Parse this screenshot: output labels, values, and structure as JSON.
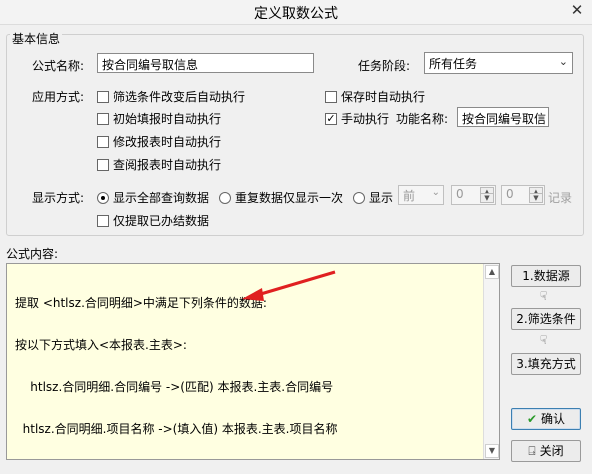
{
  "window": {
    "title": "定义取数公式",
    "close_glyph": "✕"
  },
  "basic": {
    "legend": "基本信息",
    "formula_name_label": "公式名称:",
    "formula_name_value": "按合同编号取信息",
    "task_stage_label": "任务阶段:",
    "task_stage_value": "所有任务",
    "apply_label": "应用方式:",
    "options": [
      {
        "label": "筛选条件改变后自动执行",
        "checked": false
      },
      {
        "label": "初始填报时自动执行",
        "checked": false
      },
      {
        "label": "修改报表时自动执行",
        "checked": false
      },
      {
        "label": "查阅报表时自动执行",
        "checked": false
      },
      {
        "label": "保存时自动执行",
        "checked": false
      },
      {
        "label": "手动执行",
        "checked": true
      }
    ],
    "function_name_label": "功能名称:",
    "function_name_value": "按合同编号取信",
    "display_label": "显示方式:",
    "display_options": [
      {
        "label": "显示全部查询数据",
        "selected": true
      },
      {
        "label": "重复数据仅显示一次",
        "selected": false
      },
      {
        "label": "显示",
        "selected": false
      }
    ],
    "display_pos_value": "前",
    "spin1_value": "0",
    "spin2_value": "0",
    "records_label": "记录",
    "only_done_label": "仅提取已办结数据",
    "only_done_checked": false
  },
  "formula": {
    "label": "公式内容:",
    "lines": [
      "提取 <htlsz.合同明细>中满足下列条件的数据:",
      "按以下方式填入<本报表.主表>:",
      "    htlsz.合同明细.合同编号 ->(匹配) 本报表.主表.合同编号",
      "  htlsz.合同明细.项目名称 ->(填入值) 本报表.主表.项目名称"
    ]
  },
  "side_buttons": {
    "data_source": "1.数据源",
    "filter": "2.筛选条件",
    "fill_mode": "3.填充方式",
    "ok": "确认",
    "close": "关闭"
  },
  "colors": {
    "formula_bg": "#ffffe1",
    "arrow": "#e02020",
    "ok_icon": "#2a9a2a"
  }
}
